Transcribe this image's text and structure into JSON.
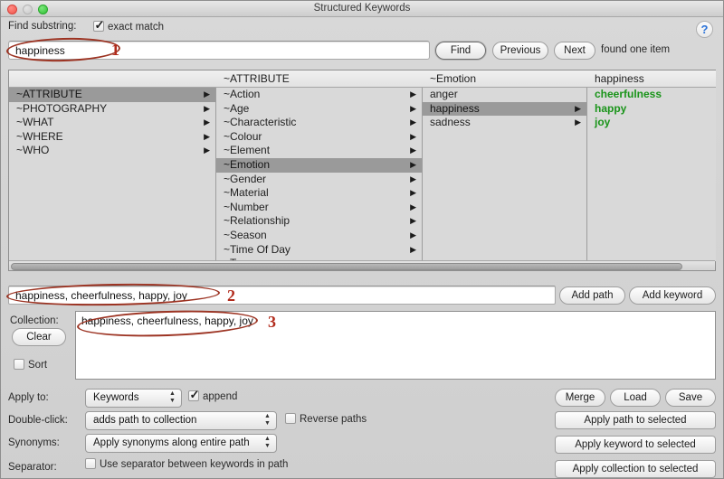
{
  "window": {
    "title": "Structured Keywords",
    "traffic_lights": [
      "close-button",
      "minimize-button",
      "maximize-button"
    ]
  },
  "find_bar": {
    "label": "Find substring:",
    "exact_match_label": "exact match",
    "exact_match_checked": true,
    "search_value": "happiness",
    "search_placeholder": "",
    "find_label": "Find",
    "previous_label": "Previous",
    "next_label": "Next",
    "status": "found one item",
    "help_label": "?"
  },
  "browser": {
    "columns": [
      {
        "header": "",
        "items": [
          {
            "label": "~ATTRIBUTE",
            "selected": true,
            "arrow": true,
            "green": false
          },
          {
            "label": "~PHOTOGRAPHY",
            "selected": false,
            "arrow": true,
            "green": false
          },
          {
            "label": "~WHAT",
            "selected": false,
            "arrow": true,
            "green": false
          },
          {
            "label": "~WHERE",
            "selected": false,
            "arrow": true,
            "green": false
          },
          {
            "label": "~WHO",
            "selected": false,
            "arrow": true,
            "green": false
          }
        ]
      },
      {
        "header": "~ATTRIBUTE",
        "items": [
          {
            "label": "~Action",
            "selected": false,
            "arrow": true,
            "green": false
          },
          {
            "label": "~Age",
            "selected": false,
            "arrow": true,
            "green": false
          },
          {
            "label": "~Characteristic",
            "selected": false,
            "arrow": true,
            "green": false
          },
          {
            "label": "~Colour",
            "selected": false,
            "arrow": true,
            "green": false
          },
          {
            "label": "~Element",
            "selected": false,
            "arrow": true,
            "green": false
          },
          {
            "label": "~Emotion",
            "selected": true,
            "arrow": true,
            "green": false
          },
          {
            "label": "~Gender",
            "selected": false,
            "arrow": true,
            "green": false
          },
          {
            "label": "~Material",
            "selected": false,
            "arrow": true,
            "green": false
          },
          {
            "label": "~Number",
            "selected": false,
            "arrow": true,
            "green": false
          },
          {
            "label": "~Relationship",
            "selected": false,
            "arrow": true,
            "green": false
          },
          {
            "label": "~Season",
            "selected": false,
            "arrow": true,
            "green": false
          },
          {
            "label": "~Time Of Day",
            "selected": false,
            "arrow": true,
            "green": false
          },
          {
            "label": "~Type",
            "selected": false,
            "arrow": true,
            "green": false
          }
        ]
      },
      {
        "header": "~Emotion",
        "items": [
          {
            "label": "anger",
            "selected": false,
            "arrow": false,
            "green": false
          },
          {
            "label": "happiness",
            "selected": true,
            "arrow": true,
            "green": false
          },
          {
            "label": "sadness",
            "selected": false,
            "arrow": true,
            "green": false
          }
        ]
      },
      {
        "header": "happiness",
        "items": [
          {
            "label": "cheerfulness",
            "selected": false,
            "arrow": false,
            "green": true
          },
          {
            "label": "happy",
            "selected": false,
            "arrow": false,
            "green": true
          },
          {
            "label": "joy",
            "selected": false,
            "arrow": false,
            "green": true
          }
        ]
      }
    ]
  },
  "path_row": {
    "value": "happiness, cheerfulness, happy, joy",
    "add_path_label": "Add path",
    "add_keyword_label": "Add keyword"
  },
  "collection": {
    "label": "Collection:",
    "value": "happiness, cheerfulness, happy, joy",
    "clear_label": "Clear",
    "sort_label": "Sort",
    "sort_checked": false
  },
  "controls": {
    "apply_to_label": "Apply to:",
    "apply_to_value": "Keywords",
    "append_label": "append",
    "append_checked": true,
    "double_click_label": "Double-click:",
    "double_click_value": "adds path to collection",
    "reverse_paths_label": "Reverse paths",
    "reverse_paths_checked": false,
    "synonyms_label": "Synonyms:",
    "synonyms_value": "Apply synonyms along entire path",
    "separator_label": "Separator:",
    "separator_checkbox_label": "Use separator between keywords in path",
    "separator_checked": false,
    "merge_label": "Merge",
    "load_label": "Load",
    "save_label": "Save",
    "apply_path_label": "Apply path to selected",
    "apply_keyword_label": "Apply keyword to selected",
    "apply_collection_label": "Apply collection to selected"
  },
  "annotations": [
    {
      "number": "1"
    },
    {
      "number": "2"
    },
    {
      "number": "3"
    }
  ],
  "colors": {
    "synonym_green": "#199419",
    "annotation_red": "#b22b1c",
    "selection_gray": "#9a9a9a",
    "help_blue": "#2a72d8"
  }
}
